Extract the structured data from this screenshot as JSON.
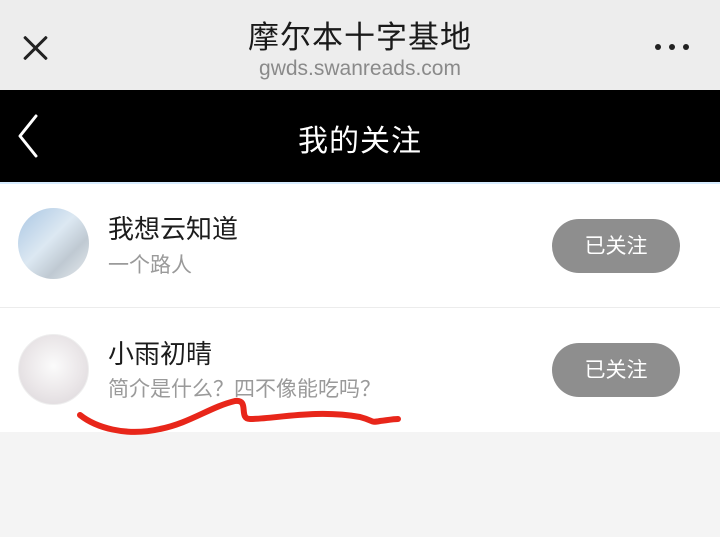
{
  "browser": {
    "title": "摩尔本十字基地",
    "url": "gwds.swanreads.com",
    "close_icon": "close-icon",
    "more_icon": "more-dots-icon"
  },
  "nav": {
    "title": "我的关注",
    "back_icon": "chevron-left-icon"
  },
  "following": [
    {
      "name": "我想云知道",
      "bio": "一个路人",
      "button_label": "已关注"
    },
    {
      "name": "小雨初晴",
      "bio": "简介是什么？四不像能吃吗？",
      "button_label": "已关注"
    }
  ],
  "colors": {
    "navbar_bg": "#000000",
    "topbar_bg": "#ededed",
    "button_bg": "#8e8e8e",
    "annotation_stroke": "#e8261a"
  }
}
